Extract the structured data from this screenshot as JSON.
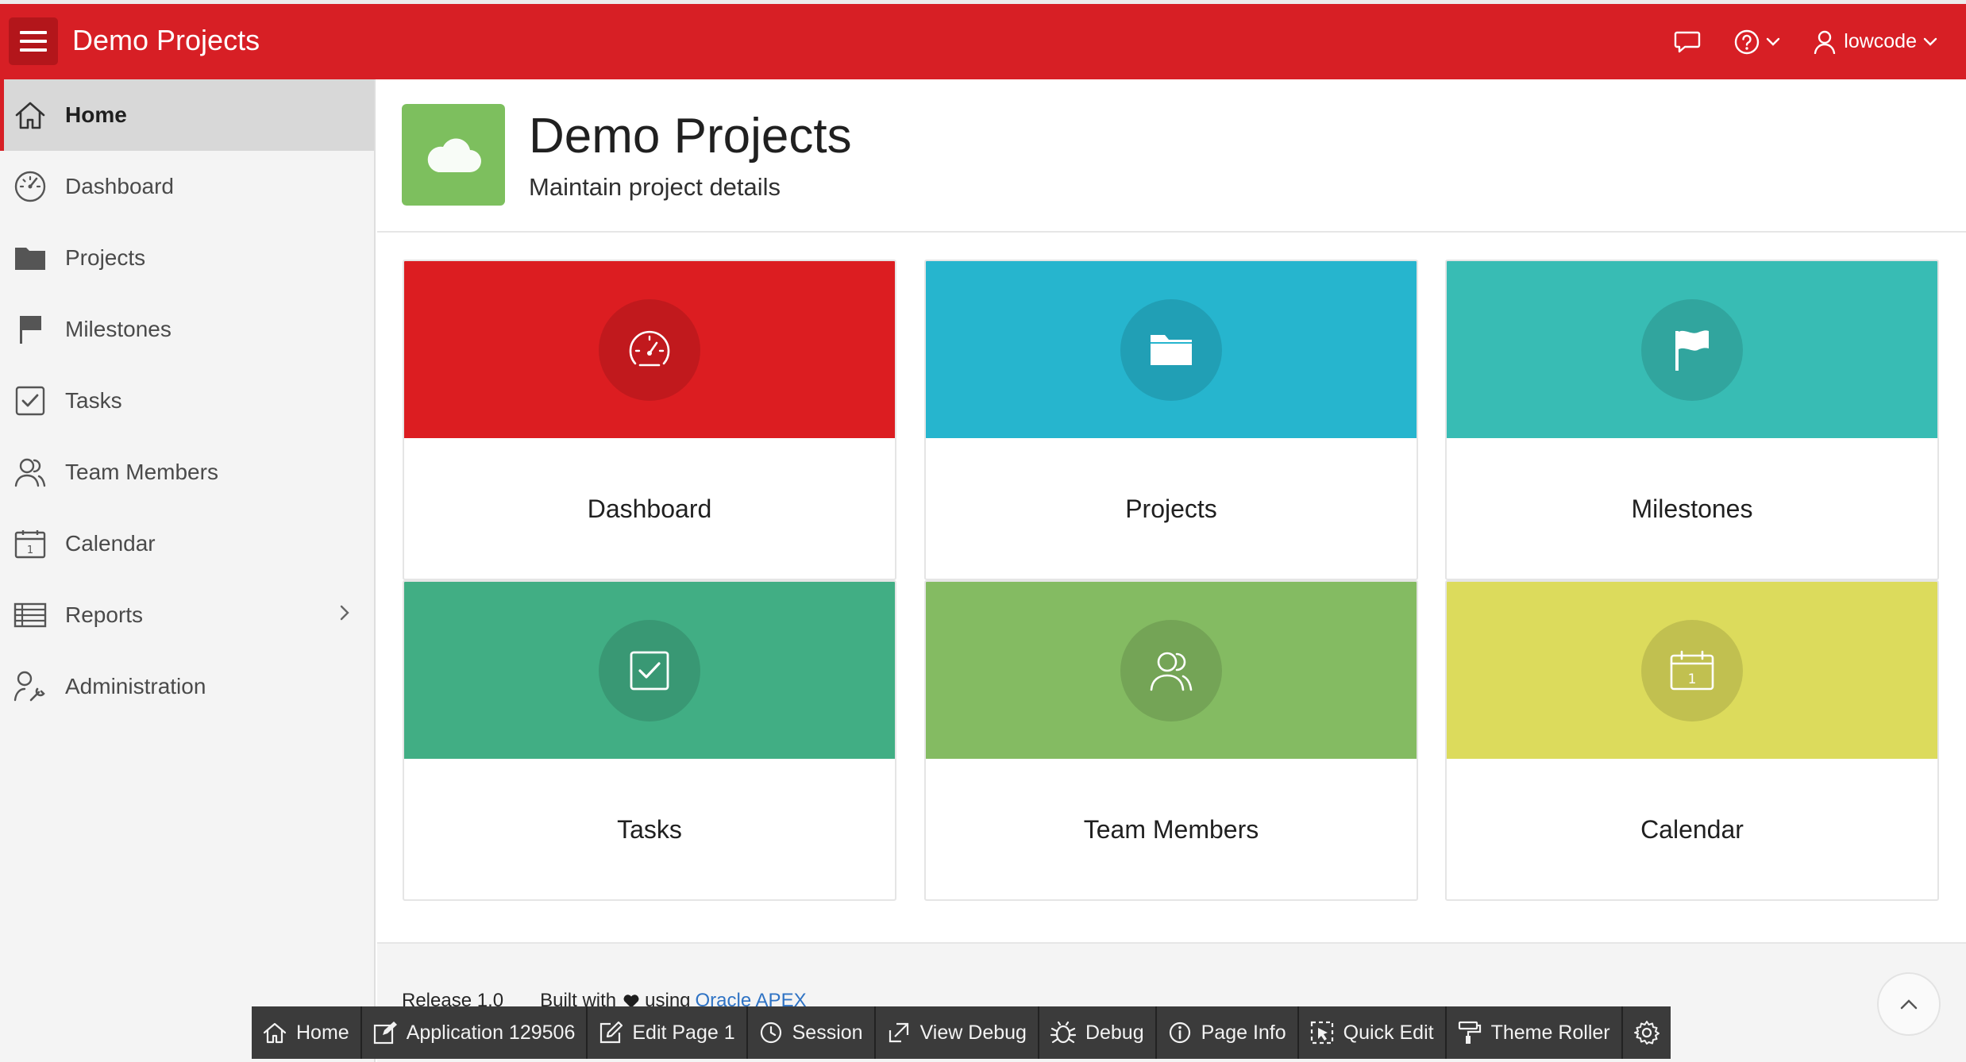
{
  "colors": {
    "brand": "#d71f25",
    "hero_icon": "#7dbf5e"
  },
  "header": {
    "title": "Demo Projects",
    "user_name": "lowcode",
    "icons": [
      "menu-icon",
      "chat-icon",
      "help-icon",
      "user-icon"
    ]
  },
  "sidebar": {
    "items": [
      {
        "label": "Home",
        "icon": "home-icon",
        "active": true
      },
      {
        "label": "Dashboard",
        "icon": "dashboard-icon"
      },
      {
        "label": "Projects",
        "icon": "folder-icon"
      },
      {
        "label": "Milestones",
        "icon": "flag-icon"
      },
      {
        "label": "Tasks",
        "icon": "checkbox-icon"
      },
      {
        "label": "Team Members",
        "icon": "users-icon"
      },
      {
        "label": "Calendar",
        "icon": "calendar-icon"
      },
      {
        "label": "Reports",
        "icon": "table-icon",
        "has_children": true
      },
      {
        "label": "Administration",
        "icon": "user-wrench-icon"
      }
    ]
  },
  "hero": {
    "title": "Demo Projects",
    "subtitle": "Maintain project details",
    "icon": "cloud-icon"
  },
  "cards": [
    {
      "label": "Dashboard",
      "color": "#dc1d21",
      "icon": "dashboard-icon"
    },
    {
      "label": "Projects",
      "color": "#26b5ce",
      "icon": "folder-icon"
    },
    {
      "label": "Milestones",
      "color": "#38bcb4",
      "icon": "flag-icon"
    },
    {
      "label": "Tasks",
      "color": "#41ae84",
      "icon": "checkbox-icon"
    },
    {
      "label": "Team Members",
      "color": "#84bb62",
      "icon": "users-icon"
    },
    {
      "label": "Calendar",
      "color": "#dcdb5c",
      "icon": "calendar-icon"
    }
  ],
  "footer": {
    "release": "Release 1.0",
    "built_with": "Built with",
    "using": "using",
    "link": "Oracle APEX"
  },
  "devbar": {
    "items": [
      {
        "label": "Home",
        "icon": "home-icon"
      },
      {
        "label": "Application 129506",
        "icon": "edit-square-icon"
      },
      {
        "label": "Edit Page 1",
        "icon": "pencil-square-icon"
      },
      {
        "label": "Session",
        "icon": "clock-icon"
      },
      {
        "label": "View Debug",
        "icon": "external-link-icon"
      },
      {
        "label": "Debug",
        "icon": "bug-icon"
      },
      {
        "label": "Page Info",
        "icon": "info-icon"
      },
      {
        "label": "Quick Edit",
        "icon": "cursor-select-icon"
      },
      {
        "label": "Theme Roller",
        "icon": "paint-roller-icon"
      },
      {
        "label": "",
        "icon": "gear-icon"
      }
    ]
  }
}
